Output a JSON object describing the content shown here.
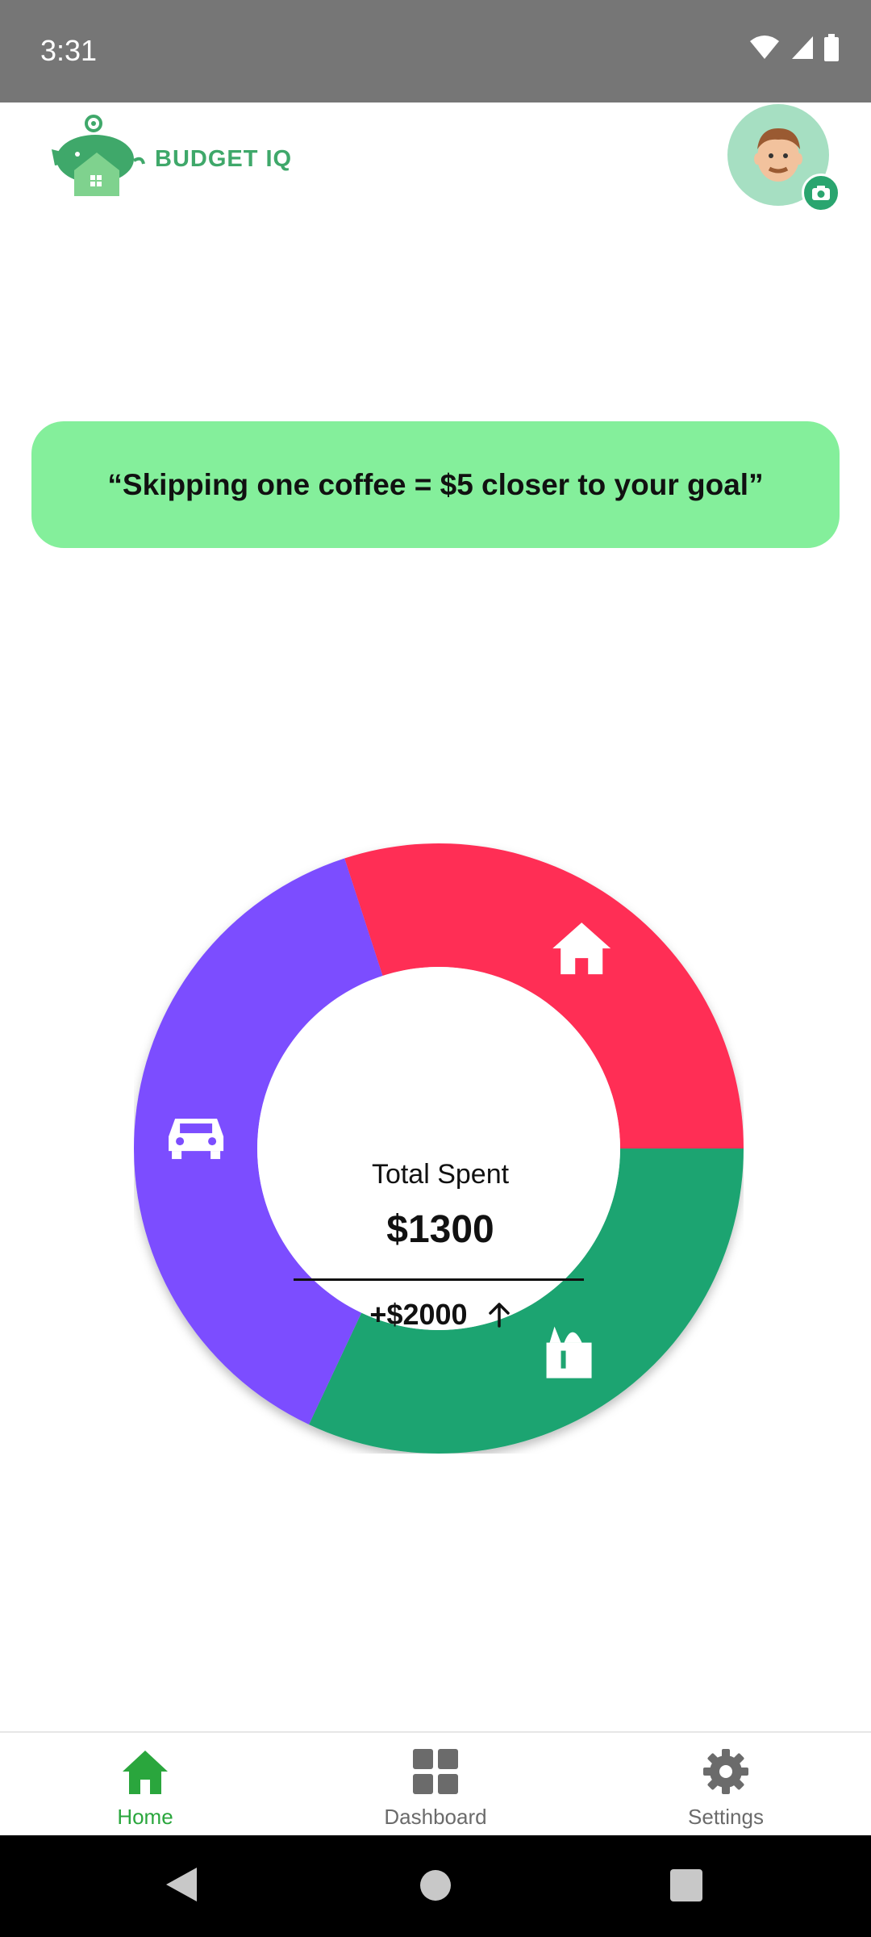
{
  "status_bar": {
    "time": "3:31",
    "icons": [
      "wifi-icon",
      "cellular-signal-icon",
      "battery-icon"
    ]
  },
  "header": {
    "brand": "BUDGET IQ",
    "logo_icon": "piggy-house-icon",
    "avatar_icon": "user-avatar",
    "camera_icon": "camera-icon"
  },
  "tip": {
    "text": "“Skipping one coffee = $5 closer to your goal”"
  },
  "summary": {
    "label": "Total Spent",
    "total": "$1300",
    "delta": "+$2000",
    "delta_icon": "arrow-up-icon"
  },
  "chart_data": {
    "type": "pie",
    "style": "donut",
    "segments": [
      {
        "icon": "home-icon",
        "color": "#ff2d55",
        "share": 0.3
      },
      {
        "icon": "grocery-icon",
        "color": "#1fa471",
        "share": 0.32
      },
      {
        "icon": "car-icon",
        "color": "#7c4dff",
        "share": 0.38
      }
    ]
  },
  "nav": {
    "items": [
      {
        "label": "Home",
        "icon": "home-icon",
        "active": true
      },
      {
        "label": "Dashboard",
        "icon": "grid-icon",
        "active": false
      },
      {
        "label": "Settings",
        "icon": "gear-icon",
        "active": false
      }
    ],
    "active_color": "#2aa63d",
    "inactive_color": "#6b6b6b"
  },
  "system_nav": [
    "back-icon",
    "home-circle-icon",
    "recents-icon"
  ]
}
